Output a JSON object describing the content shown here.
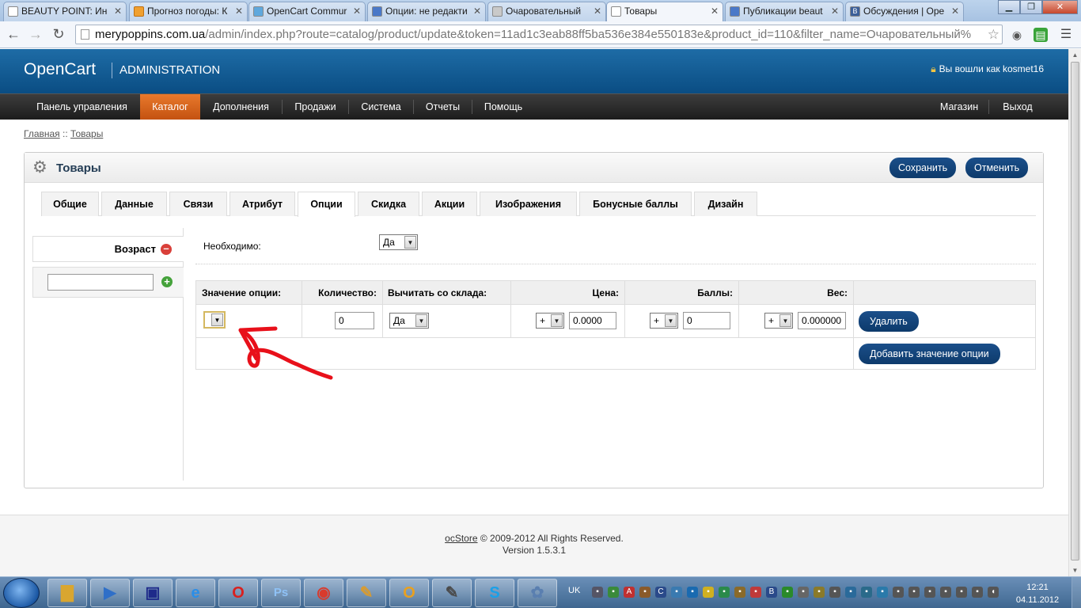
{
  "browser": {
    "tabs": [
      {
        "title": "BEAUTY POINT: Ин",
        "active": false
      },
      {
        "title": "Прогноз погоды: К",
        "active": false
      },
      {
        "title": "OpenCart Commur",
        "active": false
      },
      {
        "title": "Опции: не редакти",
        "active": false
      },
      {
        "title": "Очаровательный",
        "active": false
      },
      {
        "title": "Товары",
        "active": true
      },
      {
        "title": "Публикации beaut",
        "active": false
      },
      {
        "title": "Обсуждения | Ope",
        "active": false
      }
    ],
    "url_host": "merypoppins.com.ua",
    "url_path": "/admin/index.php?route=catalog/product/update&token=11ad1c3eab88ff5ba536e384e550183e&product_id=110&filter_name=Очаровательный%"
  },
  "header": {
    "logo": "OpenCart",
    "admin_label": "ADMINISTRATION",
    "user_status": "Вы вошли как kosmet16"
  },
  "menu": {
    "left": [
      "Панель управления",
      "Каталог",
      "Дополнения",
      "Продажи",
      "Система",
      "Отчеты",
      "Помощь"
    ],
    "right": [
      "Магазин",
      "Выход"
    ],
    "active": "Каталог"
  },
  "breadcrumb": {
    "home": "Главная",
    "separator": "::",
    "current": "Товары"
  },
  "box": {
    "title": "Товары",
    "save_button": "Сохранить",
    "cancel_button": "Отменить",
    "tabs": [
      "Общие",
      "Данные",
      "Связи",
      "Атрибут",
      "Опции",
      "Скидка",
      "Акции",
      "Изображения",
      "Бонусные баллы",
      "Дизайн"
    ],
    "active_tab": "Опции"
  },
  "options": {
    "list": [
      {
        "name": "Возраст"
      }
    ],
    "new_option_value": "",
    "required_label": "Необходимо:",
    "required_value": "Да",
    "table": {
      "headers": [
        "Значение опции:",
        "Количество:",
        "Вычитать со склада:",
        "Цена:",
        "Баллы:",
        "Вес:"
      ],
      "row": {
        "option_value": "",
        "quantity": "0",
        "subtract": "Да",
        "price_prefix": "+",
        "price": "0.0000",
        "points_prefix": "+",
        "points": "0",
        "weight_prefix": "+",
        "weight": "0.000000"
      },
      "remove_button": "Удалить",
      "add_button": "Добавить значение опции"
    }
  },
  "footer": {
    "brand": "ocStore",
    "copyright": "© 2009-2012 All Rights Reserved.",
    "version": "Version 1.5.3.1"
  },
  "taskbar": {
    "language": "UK",
    "time": "12:21",
    "date": "04.11.2012"
  },
  "colors": {
    "header_blue": "#0a4d83",
    "menu_active_orange": "#c45211",
    "button_blue": "#0d3a6b",
    "annotation_red": "#e8101a"
  }
}
